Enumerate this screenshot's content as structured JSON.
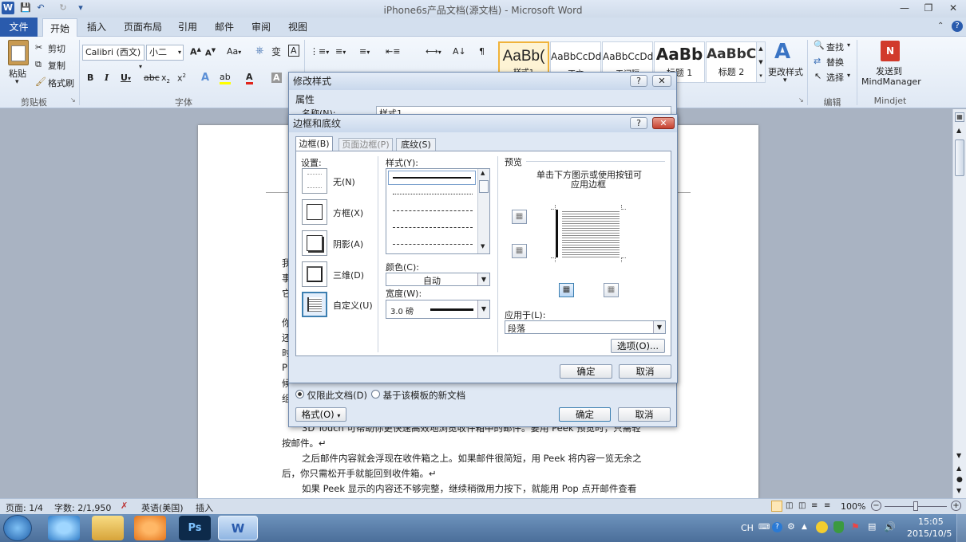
{
  "window": {
    "title": "iPhone6s产品文档(源文档) - Microsoft Word",
    "icon": "word-icon"
  },
  "quick_access": {
    "items": [
      "save-icon",
      "undo-icon",
      "redo-icon",
      "customize-icon"
    ]
  },
  "tabs": [
    {
      "label": "文件"
    },
    {
      "label": "开始"
    },
    {
      "label": "插入"
    },
    {
      "label": "页面布局"
    },
    {
      "label": "引用"
    },
    {
      "label": "邮件"
    },
    {
      "label": "审阅"
    },
    {
      "label": "视图"
    }
  ],
  "ribbon": {
    "clipboard": {
      "paste": "粘贴",
      "cut": "剪切",
      "copy": "复制",
      "format_painter": "格式刷",
      "label": "剪贴板"
    },
    "font": {
      "name": "Calibri (西文)",
      "size": "小二",
      "label": "字体",
      "aa": "Aa"
    },
    "styles": {
      "items": [
        {
          "preview": "AaBb(",
          "name": "样式1"
        },
        {
          "preview": "AaBbCcDd",
          "name": "正文"
        },
        {
          "preview": "AaBbCcDd",
          "name": "无间隔"
        },
        {
          "preview": "AaBb",
          "name": "标题 1"
        },
        {
          "preview": "AaBbC",
          "name": "标题 2"
        }
      ],
      "change": "更改样式",
      "label": "样式"
    },
    "editing": {
      "find": "查找",
      "replace": "替换",
      "select": "选择",
      "label": "编辑"
    },
    "mindjet": {
      "send": "发送到",
      "app": "MindManager",
      "label": "Mindjet"
    }
  },
  "document": {
    "lines": [
      {
        "text": "3D Touch 可帮助你更快速高效地浏览收件箱中的邮件。要用 Peek 预览时，只需轻",
        "indent": true
      },
      {
        "text": "按邮件。↵",
        "indent": false
      },
      {
        "text": "之后邮件内容就会浮现在收件箱之上。如果邮件很简短，用 Peek 将内容一览无余之",
        "indent": true
      },
      {
        "text": "后，你只需松开手就能回到收件箱。↵",
        "indent": false
      },
      {
        "text": "如果 Peek 显示的内容还不够完整，继续稍微用力按下，就能用 Pop 点开邮件查看",
        "indent": true
      }
    ],
    "left_margin_chars": [
      "我",
      "事",
      "它",
      "",
      "你",
      "还",
      "时",
      "P",
      "候",
      "组"
    ]
  },
  "modify_style_dialog": {
    "title": "修改样式",
    "section": "属性",
    "name_label": "名称(N):",
    "name_value": "样式1",
    "only_this_doc": "仅限此文档(D)",
    "new_docs": "基于该模板的新文档",
    "format_btn": "格式(O)",
    "ok": "确定",
    "cancel": "取消"
  },
  "borders_dialog": {
    "title": "边框和底纹",
    "tabs": [
      "边框(B)",
      "页面边框(P)",
      "底纹(S)"
    ],
    "settings_label": "设置:",
    "settings": [
      "无(N)",
      "方框(X)",
      "阴影(A)",
      "三维(D)",
      "自定义(U)"
    ],
    "style_label": "样式(Y):",
    "color_label": "颜色(C):",
    "color_value": "自动",
    "width_label": "宽度(W):",
    "width_value": "3.0 磅",
    "preview_label": "预览",
    "preview_hint_1": "单击下方图示或使用按钮可",
    "preview_hint_2": "应用边框",
    "apply_label": "应用于(L):",
    "apply_value": "段落",
    "options_btn": "选项(O)...",
    "ok": "确定",
    "cancel": "取消"
  },
  "status": {
    "page": "页面: 1/4",
    "words": "字数: 2/1,950",
    "lang": "英语(美国)",
    "mode": "插入",
    "zoom": "100%"
  },
  "taskbar": {
    "time": "15:05",
    "date": "2015/10/5",
    "ime": "CH"
  }
}
